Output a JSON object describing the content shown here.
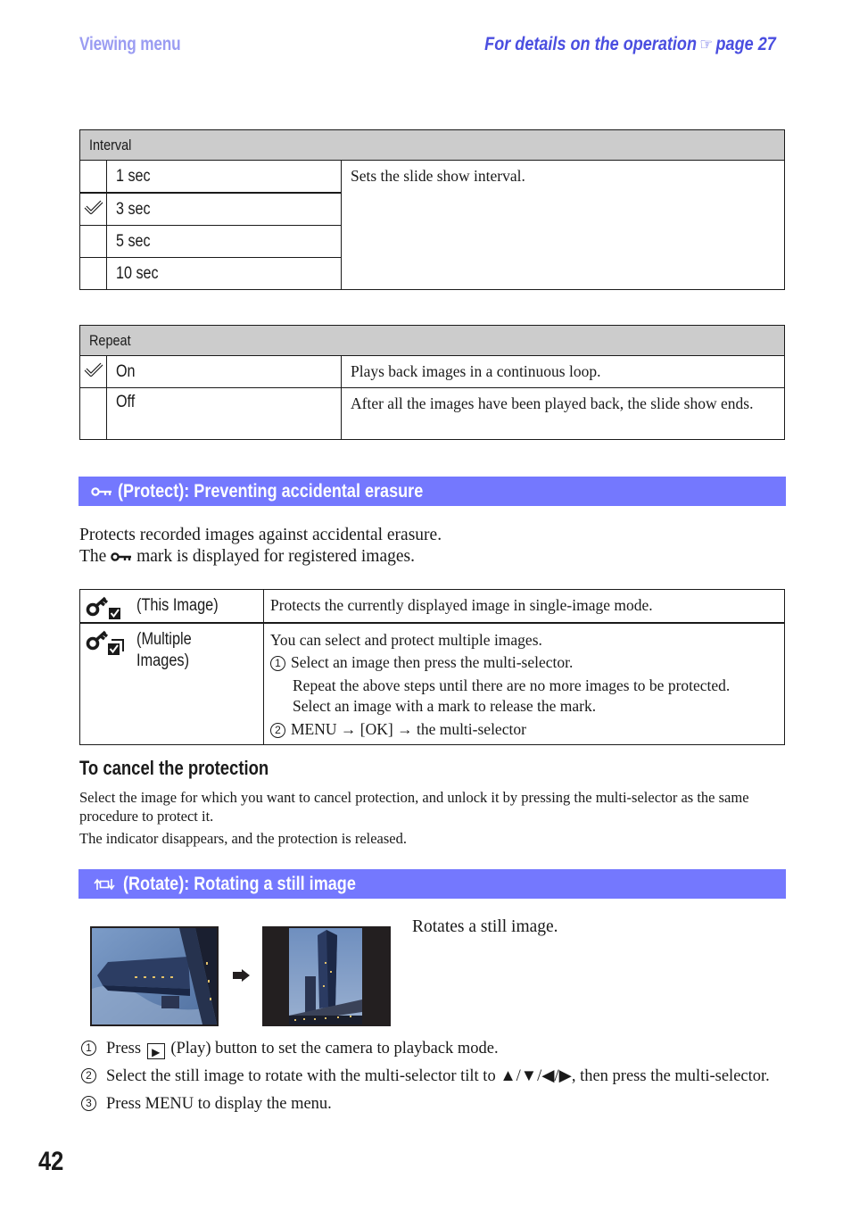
{
  "header": {
    "section": "Viewing menu",
    "details_prefix": "For details on the operation",
    "details_icon": "pointing-hand-icon",
    "details_page": "page 27"
  },
  "interval": {
    "title": "Interval",
    "description": "Sets the slide show interval.",
    "options": [
      {
        "label": "1 sec",
        "selected": false
      },
      {
        "label": "3 sec",
        "selected": true
      },
      {
        "label": "5 sec",
        "selected": false
      },
      {
        "label": "10 sec",
        "selected": false
      }
    ]
  },
  "repeat": {
    "title": "Repeat",
    "options": [
      {
        "label": "On",
        "selected": true,
        "description": "Plays back images in a continuous loop."
      },
      {
        "label": "Off",
        "selected": false,
        "description": "After all the images have been played back, the slide show ends."
      }
    ]
  },
  "protect": {
    "heading": "(Protect): Preventing accidental erasure",
    "heading_icon": "key-icon",
    "intro_line1": "Protects recorded images against accidental erasure.",
    "intro_line2_pre": "The",
    "intro_line2_post": "mark is displayed for registered images.",
    "rows": [
      {
        "icon": "key-check-icon",
        "label": "(This Image)",
        "description": "Protects the currently displayed image in single-image mode."
      },
      {
        "icon": "key-multi-check-icon",
        "label_line1": "(Multiple",
        "label_line2": "Images)",
        "description": "You can select and protect multiple images.",
        "step1_num": "1",
        "step1": "Select an image then press the multi-selector.",
        "step1_note1": "Repeat the above steps until there are no more images to be protected.",
        "step1_note2": "Select an image with a mark to release the mark.",
        "step2_num": "2",
        "step2": "MENU → [OK] → the multi-selector"
      }
    ],
    "cancel_heading": "To cancel the protection",
    "cancel_text1": "Select the image for which you want to cancel protection, and unlock it by pressing the multi-selector as the same procedure to protect it.",
    "cancel_text2": "The indicator disappears, and the protection is released."
  },
  "rotate": {
    "heading": "(Rotate): Rotating a still image",
    "heading_icon": "rotate-icon",
    "description": "Rotates a still image.",
    "steps": [
      {
        "num": "1",
        "pre": "Press",
        "icon": "play-button-icon",
        "post": "(Play) button to set the camera to playback mode."
      },
      {
        "num": "2",
        "text": "Select the still image to rotate with the multi-selector tilt to ▲/▼/◀/▶, then press the multi-selector."
      },
      {
        "num": "3",
        "text": "Press MENU to display the menu."
      }
    ]
  },
  "page_number": "42",
  "colors": {
    "section_bar": "#7478fe",
    "header_link": "#4a4ee0",
    "header_section": "#9a9cf2",
    "table_header": "#cccccc"
  }
}
